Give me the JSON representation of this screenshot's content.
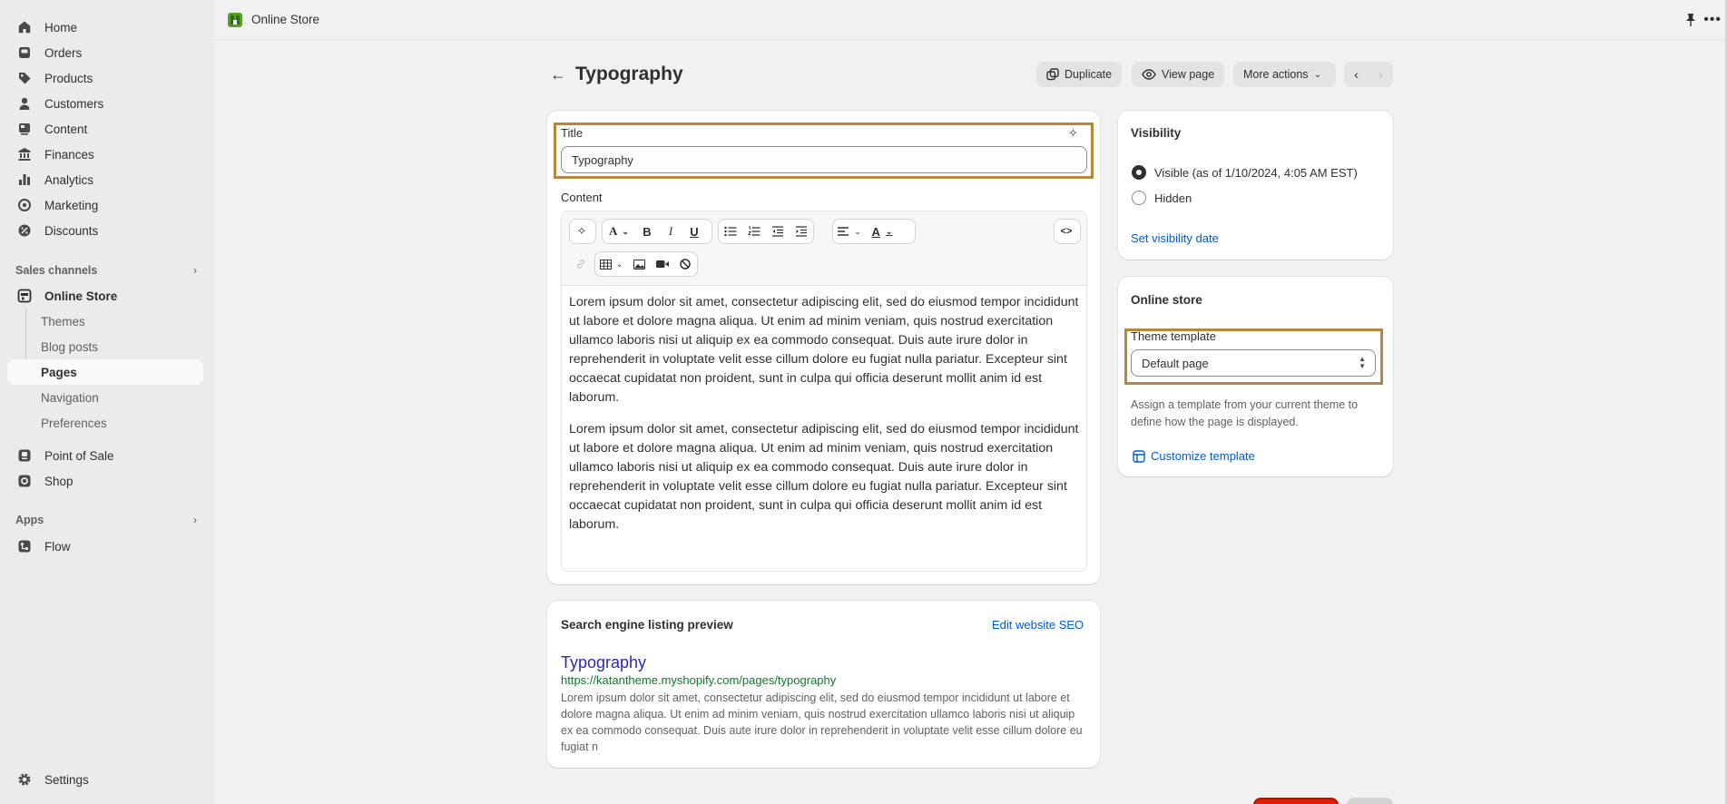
{
  "topbar": {
    "app_title": "Online Store"
  },
  "sidebar": {
    "main_items": [
      {
        "label": "Home",
        "icon": "home-icon"
      },
      {
        "label": "Orders",
        "icon": "orders-icon"
      },
      {
        "label": "Products",
        "icon": "tag-icon"
      },
      {
        "label": "Customers",
        "icon": "person-icon"
      },
      {
        "label": "Content",
        "icon": "content-icon"
      },
      {
        "label": "Finances",
        "icon": "bank-icon"
      },
      {
        "label": "Analytics",
        "icon": "bar-chart-icon"
      },
      {
        "label": "Marketing",
        "icon": "target-icon"
      },
      {
        "label": "Discounts",
        "icon": "discount-icon"
      }
    ],
    "sales_channels_label": "Sales channels",
    "online_store": {
      "label": "Online Store",
      "icon": "store-icon"
    },
    "sub_items": [
      "Themes",
      "Blog posts",
      "Pages",
      "Navigation",
      "Preferences"
    ],
    "point_of_sale": "Point of Sale",
    "shop": "Shop",
    "apps_label": "Apps",
    "flow": "Flow",
    "settings": "Settings"
  },
  "header": {
    "title": "Typography",
    "duplicate": "Duplicate",
    "view_page": "View page",
    "more_actions": "More actions"
  },
  "content_card": {
    "title_label": "Title",
    "title_value": "Typography",
    "content_label": "Content",
    "paragraphs": [
      "Lorem ipsum dolor sit amet, consectetur adipiscing elit, sed do eiusmod tempor incididunt ut labore et dolore magna aliqua. Ut enim ad minim veniam, quis nostrud exercitation ullamco laboris nisi ut aliquip ex ea commodo consequat. Duis aute irure dolor in reprehenderit in voluptate velit esse cillum dolore eu fugiat nulla pariatur. Excepteur sint occaecat cupidatat non proident, sunt in culpa qui officia deserunt mollit anim id est laborum.",
      "Lorem ipsum dolor sit amet, consectetur adipiscing elit, sed do eiusmod tempor incididunt ut labore et dolore magna aliqua. Ut enim ad minim veniam, quis nostrud exercitation ullamco laboris nisi ut aliquip ex ea commodo consequat. Duis aute irure dolor in reprehenderit in voluptate velit esse cillum dolore eu fugiat nulla pariatur. Excepteur sint occaecat cupidatat non proident, sunt in culpa qui officia deserunt mollit anim id est laborum."
    ],
    "toolbar": {
      "font_glyph": "A",
      "bold": "B",
      "italic": "I",
      "underline": "U",
      "color_glyph": "A",
      "code_view": "<>"
    }
  },
  "seo_card": {
    "heading": "Search engine listing preview",
    "edit_link": "Edit website SEO",
    "page_title": "Typography",
    "url": "https://katantheme.myshopify.com/pages/typography",
    "description": "Lorem ipsum dolor sit amet, consectetur adipiscing elit, sed do eiusmod tempor incididunt ut labore et dolore magna aliqua. Ut enim ad minim veniam, quis nostrud exercitation ullamco laboris nisi ut aliquip ex ea commodo consequat. Duis aute irure dolor in reprehenderit in voluptate velit esse cillum dolore eu fugiat n"
  },
  "visibility_card": {
    "heading": "Visibility",
    "visible_label": "Visible (as of 1/10/2024, 4:05 AM EST)",
    "hidden_label": "Hidden",
    "selected": "Visible",
    "set_date_link": "Set visibility date"
  },
  "online_store_card": {
    "heading": "Online store",
    "theme_template_label": "Theme template",
    "theme_template_value": "Default page",
    "help_text": "Assign a template from your current theme to define how the page is displayed.",
    "customize_link": "Customize template"
  },
  "colors": {
    "highlight": "#b5863c",
    "link": "#005bd3",
    "seo_title": "#2c26c4",
    "seo_url": "#0b7a2a",
    "danger": "#e51c00"
  }
}
